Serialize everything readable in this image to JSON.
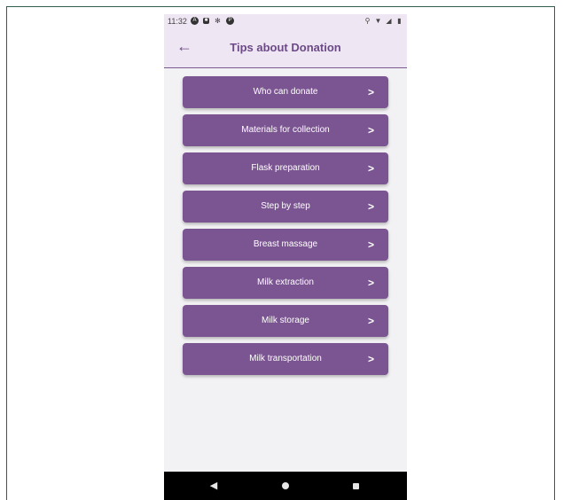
{
  "status_bar": {
    "time": "11:32",
    "left_icons": [
      "a-icon",
      "square-notification-icon",
      "settings-gear-icon",
      "p-icon"
    ],
    "right_icons": [
      "location-icon",
      "wifi-icon",
      "signal-icon",
      "battery-icon"
    ]
  },
  "app_bar": {
    "title": "Tips about Donation",
    "back_icon": "arrow-left-icon"
  },
  "menu": {
    "items": [
      {
        "label": "Who can donate"
      },
      {
        "label": "Materials for collection"
      },
      {
        "label": "Flask preparation"
      },
      {
        "label": "Step by step"
      },
      {
        "label": "Breast massage"
      },
      {
        "label": "Milk extraction"
      },
      {
        "label": "Milk storage"
      },
      {
        "label": "Milk transportation"
      }
    ],
    "chevron": ">"
  },
  "nav_bar": {
    "buttons": [
      "back-triangle-icon",
      "home-circle-icon",
      "recents-square-icon"
    ]
  },
  "colors": {
    "accent": "#7b5591",
    "app_bar_bg": "#efe6f3",
    "title": "#6b4a86",
    "background": "#f2f1f3"
  }
}
